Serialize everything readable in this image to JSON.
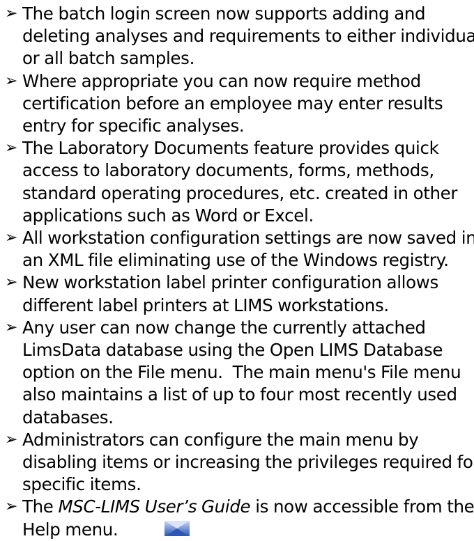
{
  "bullet_symbol": "➢",
  "bullets": [
    {
      "lines": [
        "The batch login screen now supports adding and",
        "deleting analyses and requirements to either individual",
        "or all batch samples."
      ]
    },
    {
      "lines": [
        "Where appropriate you can now require method",
        "certification before an employee may enter results",
        "entry for specific analyses."
      ]
    },
    {
      "lines": [
        "The Laboratory Documents feature provides quick",
        "access to laboratory documents, forms, methods,",
        "standard operating procedures, etc. created in other",
        "applications such as Word or Excel."
      ]
    },
    {
      "lines": [
        "All workstation configuration settings are now saved in",
        "an XML file eliminating use of the Windows registry."
      ]
    },
    {
      "lines": [
        "New workstation label printer configuration allows",
        "different label printers at LIMS workstations."
      ]
    },
    {
      "lines": [
        "Any user can now change the currently attached",
        "LimsData database using the Open LIMS Database",
        "option on the File menu.  The main menu's File menu",
        "also maintains a list of up to four most recently used",
        "databases."
      ]
    },
    {
      "lines": [
        "Administrators can configure the main menu by",
        "disabling items or increasing the privileges required for",
        "specific items."
      ]
    },
    {
      "line1_prefix": "The ",
      "line1_italic": "MSC-LIMS User’s Guide",
      "line1_suffix": " is now accessible from the",
      "line2": "Help menu."
    }
  ],
  "icons": {
    "help_icon": "bowtie-icon",
    "help_icon_colors": [
      "#2a57b8",
      "#7aa2e6",
      "#c9d8f5"
    ]
  }
}
